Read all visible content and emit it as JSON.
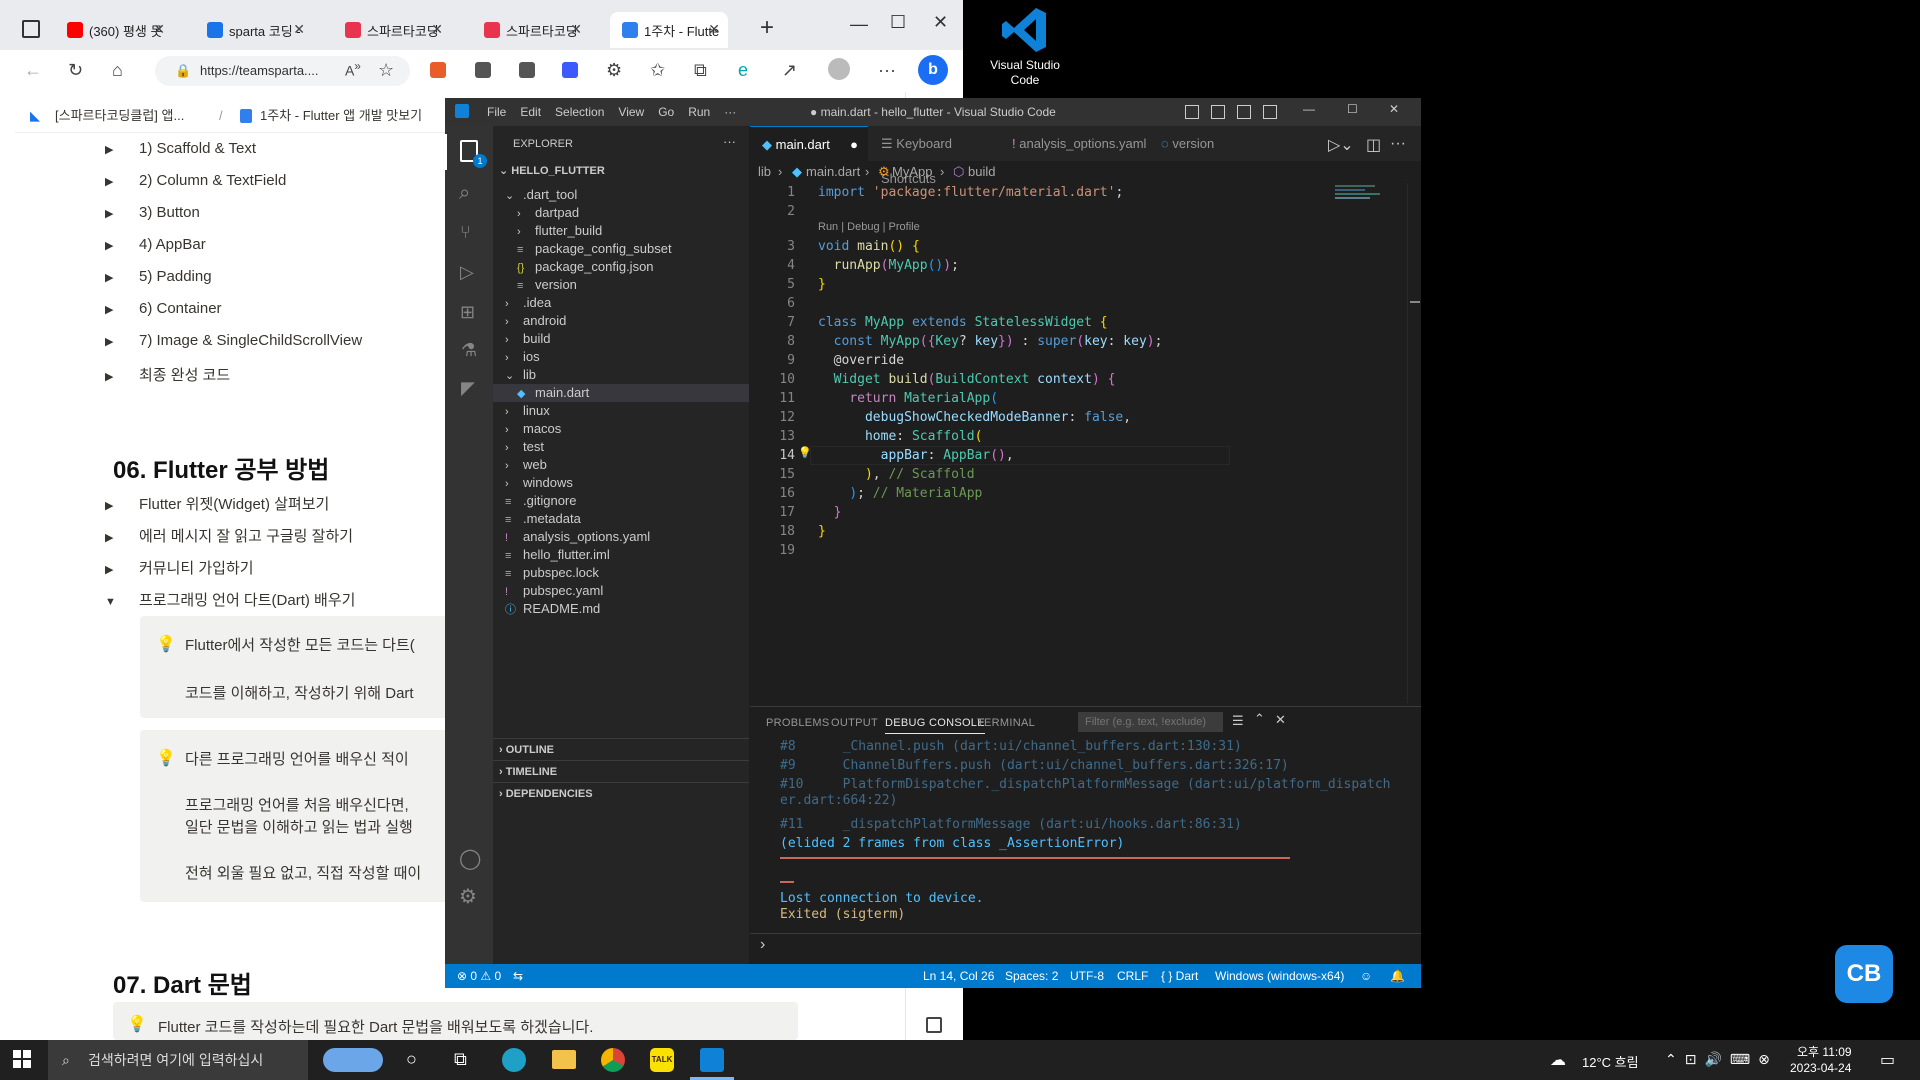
{
  "browser": {
    "tabs": [
      {
        "label": "(360) 평생 못",
        "color": "#ff0000"
      },
      {
        "label": "sparta 코딩 -",
        "color": "#1a73e8"
      },
      {
        "label": "스파르타코딩",
        "color": "#e8344e"
      },
      {
        "label": "스파르타코딩",
        "color": "#e8344e"
      },
      {
        "label": "1주차 - Flutte",
        "color": "#2f80ed"
      }
    ],
    "address": "https://teamsparta....",
    "breadcrumb1": "[스파르타코딩클럽] 앱...",
    "breadcrumb_sep": "/",
    "breadcrumb2": "1주차 - Flutter 앱 개발 맛보기",
    "toggles": [
      "1) Scaffold & Text",
      "2) Column & TextField",
      "3) Button",
      "4) AppBar",
      "5) Padding",
      "6) Container",
      "7) Image & SingleChildScrollView",
      "최종 완성 코드"
    ],
    "section6_title": "06. Flutter 공부 방법",
    "section6_items": [
      "Flutter 위젯(Widget) 살펴보기",
      "에러 메시지 잘 읽고 구글링 잘하기",
      "커뮤니티 가입하기",
      "프로그래밍 언어 다트(Dart) 배우기"
    ],
    "callout1_line1": "Flutter에서 작성한 모든 코드는 다트(",
    "callout1_line2": "코드를 이해하고, 작성하기 위해 Dart",
    "callout2_line1": "다른 프로그래밍 언어를 배우신 적이",
    "callout2_line2": "프로그래밍 언어를 처음 배우신다면,",
    "callout2_line3": "일단 문법을 이해하고 읽는 법과 실행",
    "callout2_line4": "전혀 외울 필요 없고, 직접 작성할 때이",
    "section7_title": "07. Dart 문법",
    "section7_callout": "Flutter 코드를 작성하는데 필요한 Dart 문법을 배워보도록 하겠습니다."
  },
  "vscode": {
    "menu": [
      "File",
      "Edit",
      "Selection",
      "View",
      "Go",
      "Run",
      "···"
    ],
    "title": "● main.dart - hello_flutter - Visual Studio Code",
    "explorer_header": "EXPLORER",
    "project": "HELLO_FLUTTER",
    "tree": [
      {
        "label": ".dart_tool",
        "indent": 1,
        "kind": "open"
      },
      {
        "label": "dartpad",
        "indent": 2,
        "kind": "closed"
      },
      {
        "label": "flutter_build",
        "indent": 2,
        "kind": "closed"
      },
      {
        "label": "package_config_subset",
        "indent": 2,
        "kind": "file"
      },
      {
        "label": "package_config.json",
        "indent": 2,
        "kind": "json"
      },
      {
        "label": "version",
        "indent": 2,
        "kind": "file"
      },
      {
        "label": ".idea",
        "indent": 1,
        "kind": "closed"
      },
      {
        "label": "android",
        "indent": 1,
        "kind": "closed"
      },
      {
        "label": "build",
        "indent": 1,
        "kind": "closed"
      },
      {
        "label": "ios",
        "indent": 1,
        "kind": "closed"
      },
      {
        "label": "lib",
        "indent": 1,
        "kind": "open"
      },
      {
        "label": "main.dart",
        "indent": 2,
        "kind": "dart"
      },
      {
        "label": "linux",
        "indent": 1,
        "kind": "closed"
      },
      {
        "label": "macos",
        "indent": 1,
        "kind": "closed"
      },
      {
        "label": "test",
        "indent": 1,
        "kind": "closed"
      },
      {
        "label": "web",
        "indent": 1,
        "kind": "closed"
      },
      {
        "label": "windows",
        "indent": 1,
        "kind": "closed"
      },
      {
        "label": ".gitignore",
        "indent": 1,
        "kind": "file"
      },
      {
        "label": ".metadata",
        "indent": 1,
        "kind": "file"
      },
      {
        "label": "analysis_options.yaml",
        "indent": 1,
        "kind": "yaml"
      },
      {
        "label": "hello_flutter.iml",
        "indent": 1,
        "kind": "file"
      },
      {
        "label": "pubspec.lock",
        "indent": 1,
        "kind": "file"
      },
      {
        "label": "pubspec.yaml",
        "indent": 1,
        "kind": "yaml"
      },
      {
        "label": "README.md",
        "indent": 1,
        "kind": "info"
      }
    ],
    "outline": "OUTLINE",
    "timeline": "TIMELINE",
    "dependencies": "DEPENDENCIES",
    "tabs": [
      "main.dart",
      "Keyboard Shortcuts",
      "analysis_options.yaml",
      "version"
    ],
    "breadcrumb": [
      "lib",
      "main.dart",
      "MyApp",
      "build"
    ],
    "codelens": "Run | Debug | Profile",
    "panel_tabs": [
      "PROBLEMS",
      "OUTPUT",
      "DEBUG CONSOLE",
      "TERMINAL"
    ],
    "filter_placeholder": "Filter (e.g. text, !exclude)",
    "console": [
      {
        "text": "#8      _Channel.push (dart:ui/channel_buffers.dart:130:31)",
        "color": "#3e6b8a"
      },
      {
        "text": "#9      ChannelBuffers.push (dart:ui/channel_buffers.dart:326:17)",
        "color": "#3e6b8a"
      },
      {
        "text": "#10     PlatformDispatcher._dispatchPlatformMessage (dart:ui/platform_dispatch",
        "color": "#3e6b8a"
      },
      {
        "text": "er.dart:664:22)",
        "color": "#3e6b8a"
      },
      {
        "text": "#11     _dispatchPlatformMessage (dart:ui/hooks.dart:86:31)",
        "color": "#3e6b8a"
      },
      {
        "text": "(elided 2 frames from class _AssertionError)",
        "color": "#4fc1ff"
      },
      {
        "text": "Lost connection to device.",
        "color": "#4fc1ff"
      },
      {
        "text": "Exited (sigterm)",
        "color": "#d7ba7d"
      }
    ],
    "status": {
      "problems": "⊗ 0 ⚠ 0",
      "position": "Ln 14, Col 26",
      "spaces": "Spaces: 2",
      "encoding": "UTF-8",
      "eol": "CRLF",
      "language": "{ } Dart",
      "device": "Windows (windows-x64)"
    }
  },
  "desktop": {
    "icon_label": "Visual Studio Code"
  },
  "taskbar": {
    "search_placeholder": "검색하려면 여기에 입력하십시",
    "weather": "12°C  흐림",
    "time": "오후 11:09",
    "date": "2023-04-24"
  }
}
